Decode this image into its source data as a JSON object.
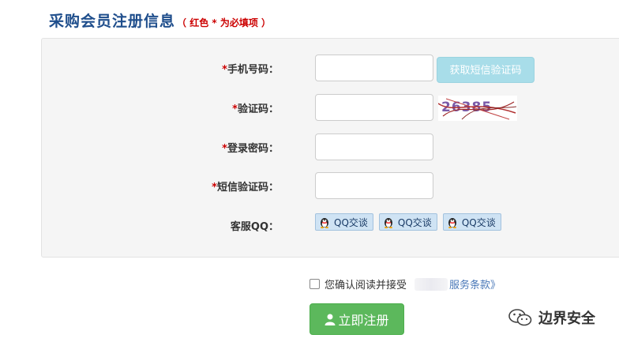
{
  "header": {
    "title": "采购会员注册信息",
    "note": "（ 红色 * 为必填项 ）"
  },
  "form": {
    "required_mark": "*",
    "phone_label": "手机号码：",
    "phone_value": "",
    "sms_button": "获取短信验证码",
    "captcha_label": "验证码：",
    "captcha_value": "",
    "captcha_text": "26385",
    "password_label": "登录密码：",
    "password_value": "",
    "sms_code_label": "短信验证码：",
    "sms_code_value": "",
    "qq_label": "客服QQ：",
    "qq_buttons": [
      "QQ交谈",
      "QQ交谈",
      "QQ交谈"
    ]
  },
  "agreement": {
    "text": "您确认阅读并接受",
    "terms_link": "服务条款》",
    "checked": false
  },
  "submit_label": "立即注册",
  "watermark": "边界安全",
  "colors": {
    "title": "#1f4e8c",
    "required": "#cc0000",
    "sms_button": "#a8dde9",
    "submit": "#5cb85c",
    "link": "#4a78b8"
  }
}
